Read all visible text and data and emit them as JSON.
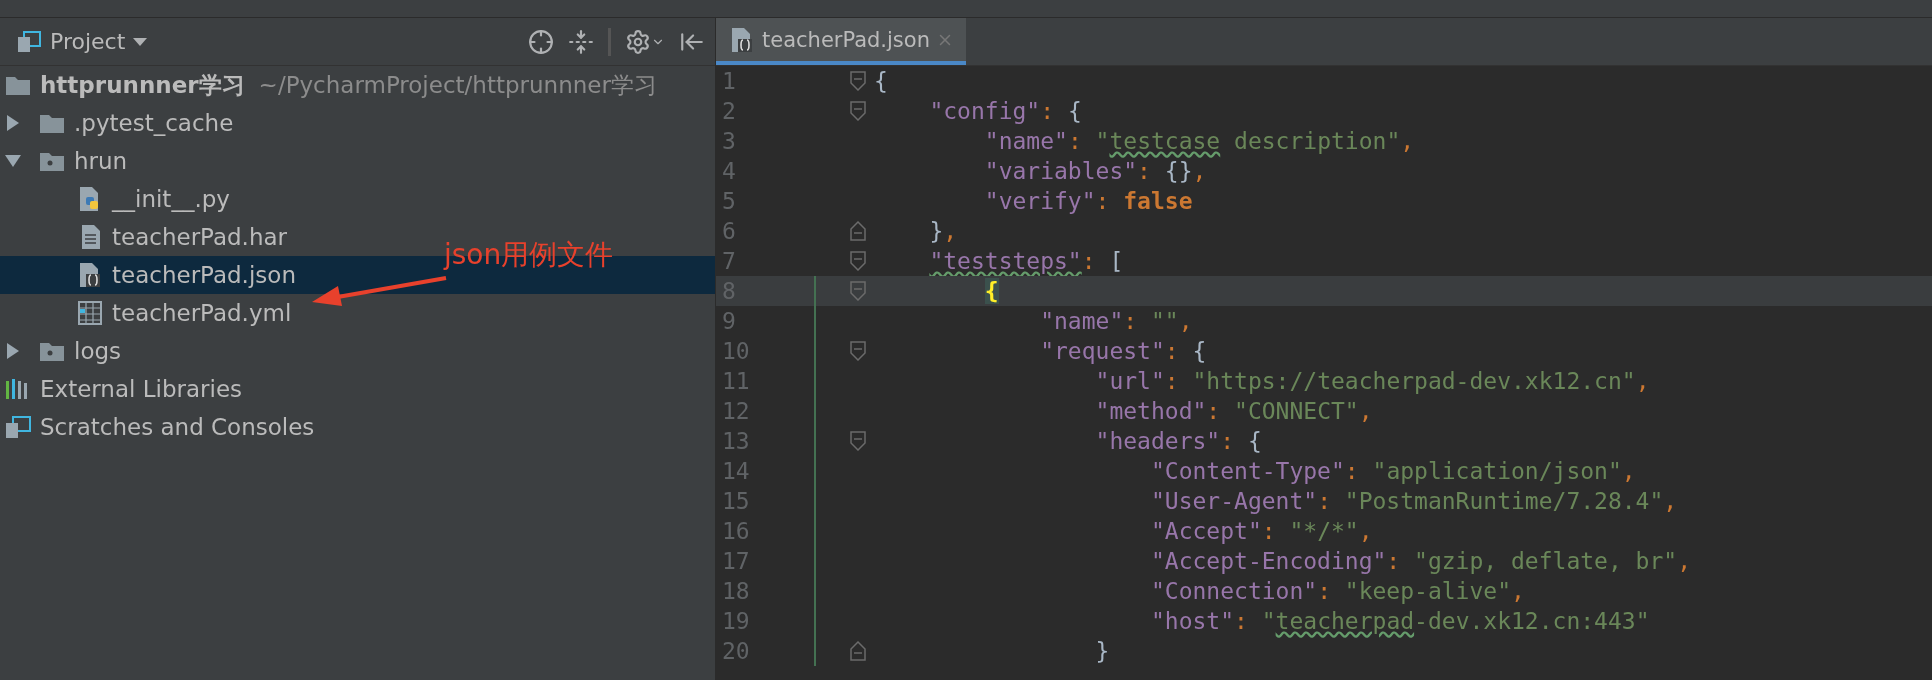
{
  "project_panel": {
    "title": "Project",
    "tree": [
      {
        "label": "httprunnner学习",
        "path": "~/PycharmProject/httprunnner学习",
        "kind": "folder",
        "selected": false,
        "children": [
          {
            "label": ".pytest_cache",
            "kind": "folder",
            "expanded": false,
            "selected": false
          },
          {
            "label": "hrun",
            "kind": "module",
            "expanded": true,
            "selected": false,
            "children": [
              {
                "label": "__init__.py",
                "kind": "python",
                "selected": false
              },
              {
                "label": "teacherPad.har",
                "kind": "text",
                "selected": false
              },
              {
                "label": "teacherPad.json",
                "kind": "json",
                "selected": true
              },
              {
                "label": "teacherPad.yml",
                "kind": "table",
                "selected": false
              }
            ]
          },
          {
            "label": "logs",
            "kind": "module",
            "expanded": false,
            "selected": false
          }
        ]
      },
      {
        "label": "External Libraries",
        "kind": "libraries",
        "selected": false
      },
      {
        "label": "Scratches and Consoles",
        "kind": "scratches",
        "selected": false
      }
    ],
    "annotation": {
      "text": "json用例文件"
    }
  },
  "editor": {
    "tabs": [
      {
        "label": "teacherPad.json",
        "selected": true
      }
    ],
    "lines": [
      {
        "number": "1",
        "kind": "fold_open",
        "current": false,
        "changed": false,
        "tokens": [
          {
            "kind": "brace",
            "text": "{"
          }
        ]
      },
      {
        "number": "2",
        "kind": "fold_open",
        "current": false,
        "changed": false,
        "tokens": [
          {
            "kind": "key",
            "text": "    \"config\""
          },
          {
            "kind": "punct",
            "text": ": "
          },
          {
            "kind": "brace",
            "text": "{"
          }
        ]
      },
      {
        "number": "3",
        "kind": "plain",
        "current": false,
        "changed": false,
        "tokens": [
          {
            "kind": "key",
            "text": "        \"name\""
          },
          {
            "kind": "punct",
            "text": ": "
          },
          {
            "kind": "string",
            "text": "\""
          },
          {
            "kind": "string_typo",
            "text": "testcase"
          },
          {
            "kind": "string",
            "text": " description\""
          },
          {
            "kind": "punct",
            "text": ","
          }
        ]
      },
      {
        "number": "4",
        "kind": "plain",
        "current": false,
        "changed": false,
        "tokens": [
          {
            "kind": "key",
            "text": "        \"variables\""
          },
          {
            "kind": "punct",
            "text": ": "
          },
          {
            "kind": "brace",
            "text": "{}"
          },
          {
            "kind": "punct",
            "text": ","
          }
        ]
      },
      {
        "number": "5",
        "kind": "plain",
        "current": false,
        "changed": false,
        "tokens": [
          {
            "kind": "key",
            "text": "        \"verify\""
          },
          {
            "kind": "punct",
            "text": ": "
          },
          {
            "kind": "bool",
            "text": "false"
          }
        ]
      },
      {
        "number": "6",
        "kind": "fold_close",
        "current": false,
        "changed": false,
        "tokens": [
          {
            "kind": "brace",
            "text": "    }"
          },
          {
            "kind": "punct",
            "text": ","
          }
        ]
      },
      {
        "number": "7",
        "kind": "fold_open",
        "current": false,
        "changed": false,
        "tokens": [
          {
            "kind": "key_typo",
            "text": "    \"teststeps\""
          },
          {
            "kind": "punct",
            "text": ": "
          },
          {
            "kind": "brace",
            "text": "["
          }
        ]
      },
      {
        "number": "8",
        "kind": "fold_open",
        "current": true,
        "changed": true,
        "tokens": [
          {
            "kind": "brace_match",
            "text": "        {"
          }
        ]
      },
      {
        "number": "9",
        "kind": "plain",
        "current": false,
        "changed": true,
        "tokens": [
          {
            "kind": "key",
            "text": "            \"name\""
          },
          {
            "kind": "punct",
            "text": ": "
          },
          {
            "kind": "string",
            "text": "\"\""
          },
          {
            "kind": "punct",
            "text": ","
          }
        ]
      },
      {
        "number": "10",
        "kind": "fold_open",
        "current": false,
        "changed": true,
        "tokens": [
          {
            "kind": "key",
            "text": "            \"request\""
          },
          {
            "kind": "punct",
            "text": ": "
          },
          {
            "kind": "brace",
            "text": "{"
          }
        ]
      },
      {
        "number": "11",
        "kind": "plain",
        "current": false,
        "changed": true,
        "tokens": [
          {
            "kind": "key",
            "text": "                \"url\""
          },
          {
            "kind": "punct",
            "text": ": "
          },
          {
            "kind": "string",
            "text": "\"https://teacherpad-dev.xk12.cn\""
          },
          {
            "kind": "punct",
            "text": ","
          }
        ]
      },
      {
        "number": "12",
        "kind": "plain",
        "current": false,
        "changed": true,
        "tokens": [
          {
            "kind": "key",
            "text": "                \"method\""
          },
          {
            "kind": "punct",
            "text": ": "
          },
          {
            "kind": "string",
            "text": "\"CONNECT\""
          },
          {
            "kind": "punct",
            "text": ","
          }
        ]
      },
      {
        "number": "13",
        "kind": "fold_open",
        "current": false,
        "changed": true,
        "tokens": [
          {
            "kind": "key",
            "text": "                \"headers\""
          },
          {
            "kind": "punct",
            "text": ": "
          },
          {
            "kind": "brace",
            "text": "{"
          }
        ]
      },
      {
        "number": "14",
        "kind": "plain",
        "current": false,
        "changed": true,
        "tokens": [
          {
            "kind": "key",
            "text": "                    \"Content-Type\""
          },
          {
            "kind": "punct",
            "text": ": "
          },
          {
            "kind": "string",
            "text": "\"application/json\""
          },
          {
            "kind": "punct",
            "text": ","
          }
        ]
      },
      {
        "number": "15",
        "kind": "plain",
        "current": false,
        "changed": true,
        "tokens": [
          {
            "kind": "key",
            "text": "                    \"User-Agent\""
          },
          {
            "kind": "punct",
            "text": ": "
          },
          {
            "kind": "string",
            "text": "\"PostmanRuntime/7.28.4\""
          },
          {
            "kind": "punct",
            "text": ","
          }
        ]
      },
      {
        "number": "16",
        "kind": "plain",
        "current": false,
        "changed": true,
        "tokens": [
          {
            "kind": "key",
            "text": "                    \"Accept\""
          },
          {
            "kind": "punct",
            "text": ": "
          },
          {
            "kind": "string",
            "text": "\"*/*\""
          },
          {
            "kind": "punct",
            "text": ","
          }
        ]
      },
      {
        "number": "17",
        "kind": "plain",
        "current": false,
        "changed": true,
        "tokens": [
          {
            "kind": "key",
            "text": "                    \"Accept-Encoding\""
          },
          {
            "kind": "punct",
            "text": ": "
          },
          {
            "kind": "string",
            "text": "\"gzip, deflate, br\""
          },
          {
            "kind": "punct",
            "text": ","
          }
        ]
      },
      {
        "number": "18",
        "kind": "plain",
        "current": false,
        "changed": true,
        "tokens": [
          {
            "kind": "key",
            "text": "                    \"Connection\""
          },
          {
            "kind": "punct",
            "text": ": "
          },
          {
            "kind": "string",
            "text": "\"keep-alive\""
          },
          {
            "kind": "punct",
            "text": ","
          }
        ]
      },
      {
        "number": "19",
        "kind": "plain",
        "current": false,
        "changed": true,
        "tokens": [
          {
            "kind": "key",
            "text": "                    \"host\""
          },
          {
            "kind": "punct",
            "text": ": "
          },
          {
            "kind": "string",
            "text": "\""
          },
          {
            "kind": "string_typo",
            "text": "teacherpad"
          },
          {
            "kind": "string",
            "text": "-dev.xk12.cn:443\""
          }
        ]
      },
      {
        "number": "20",
        "kind": "fold_close",
        "current": false,
        "changed": true,
        "tokens": [
          {
            "kind": "brace",
            "text": "                }"
          }
        ]
      }
    ]
  }
}
